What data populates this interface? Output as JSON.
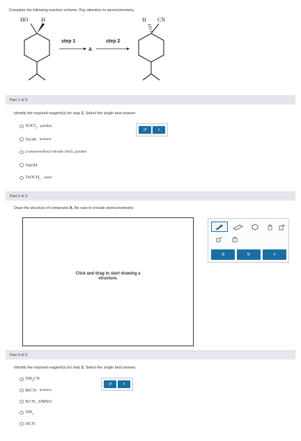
{
  "instructions": "Complete the following reaction scheme. Pay attention to stereochemistry.",
  "scheme": {
    "reactant_label_left": "HO",
    "reactant_label_right": "H",
    "product_label_left": "H",
    "product_label_right": "CN",
    "step1_label": "step 1",
    "intermediate_label": "A",
    "step2_label": "step 2"
  },
  "part1": {
    "header": "Part 1 of 3",
    "question_prefix": "Identify the required reagent(s) for step ",
    "question_step": "1.",
    "question_suffix": " Select the single best answer.",
    "options": [
      {
        "chem": "SOCl",
        "sub": "2",
        "rest": ", pyridine"
      },
      {
        "chem": "TsOH",
        "sub": "",
        "rest": ", acetone"
      },
      {
        "pre": "p",
        "rest": "-toluenesulfonyl chloride (TsCl), pyridine"
      },
      {
        "chem": "NaOH",
        "sub": "",
        "rest": ""
      },
      {
        "chem": "TsOCH",
        "sub": "3",
        "rest": ", water"
      }
    ],
    "undo_icon": "↺",
    "clear_icon": "×"
  },
  "part2": {
    "header": "Part 2 of 3",
    "question_prefix": "Draw the structure of compound ",
    "question_bold": "A.",
    "question_suffix": " Be sure to include stereochemistry.",
    "canvas_hint_line1": "Click and drag to start drawing a",
    "canvas_hint_line2": "structure.",
    "undo_icon": "↺",
    "redo_icon": "↻",
    "clear_icon": "×"
  },
  "part3": {
    "header": "Part 3 of 3",
    "question_prefix": "Identify the required reagent(s) for step ",
    "question_step": "2.",
    "question_suffix": " Select the single best answer.",
    "options": [
      {
        "chem": "NH",
        "sub": "4",
        "chem2": "CN",
        "rest": ""
      },
      {
        "chem": "BrCN",
        "sub": "",
        "rest": ", acetone"
      },
      {
        "chem": "KCN",
        "sub": "",
        "rest": ", DMSO"
      },
      {
        "chem": "NH",
        "sub": "3",
        "rest": ""
      },
      {
        "chem": "HCN",
        "sub": "",
        "rest": ""
      }
    ],
    "undo_icon": "↺",
    "clear_icon": "×"
  },
  "colors": {
    "accent": "#1b6ea3",
    "header_bg": "#e4e8ee"
  }
}
